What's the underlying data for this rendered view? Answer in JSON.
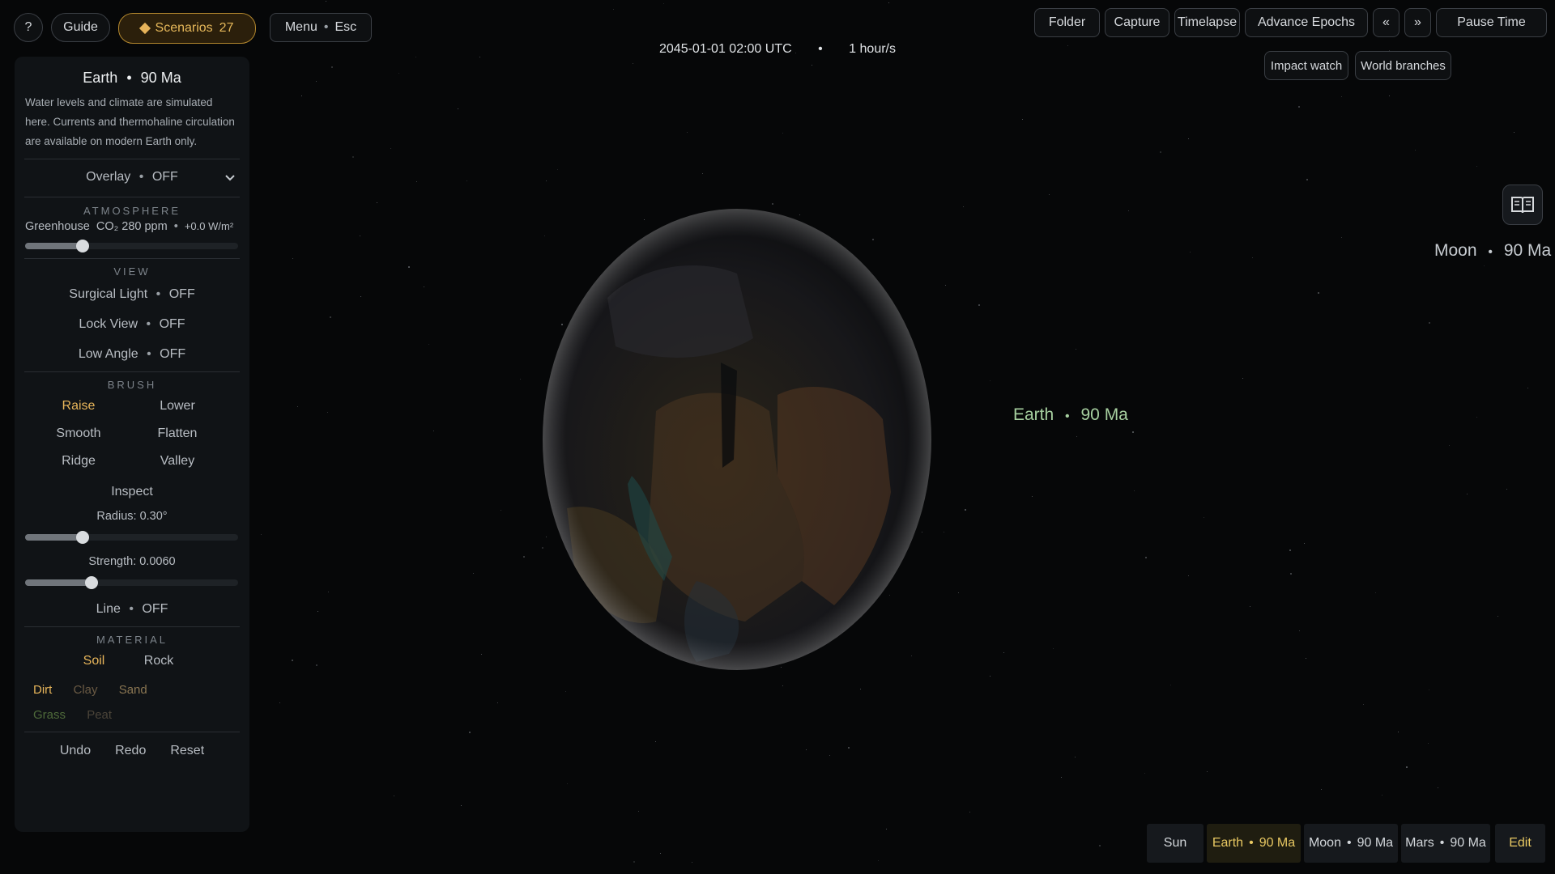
{
  "topleft": {
    "help_label": "?",
    "guide_label": "Guide",
    "scenarios_label": "Scenarios",
    "scenarios_count": "27",
    "menu_label": "Menu",
    "menu_key": "Esc"
  },
  "time": {
    "datetime": "2045-01-01 02:00 UTC",
    "rate": "1 hour/s",
    "sep": "•"
  },
  "topright": {
    "folder": "Folder",
    "capture": "Capture",
    "timelapse": "Timelapse",
    "advance_epochs": "Advance Epochs",
    "prev": "«",
    "next": "»",
    "pause": "Pause Time",
    "impact_watch": "Impact watch",
    "world_branches": "World branches"
  },
  "panel": {
    "title_body": "Earth",
    "title_epoch": "90 Ma",
    "description": "Water levels and climate are simulated here. Currents and thermohaline circulation are available on modern Earth only.",
    "overlay_label": "Overlay",
    "overlay_value": "OFF",
    "atmosphere_header": "ATMOSPHERE",
    "greenhouse_label": "Greenhouse",
    "greenhouse_co2": "CO₂ 280 ppm",
    "greenhouse_forcing": "+0.0 W/m²",
    "greenhouse_level": 0.27,
    "view_header": "VIEW",
    "surgical_label": "Surgical Light",
    "surgical_value": "OFF",
    "lock_label": "Lock View",
    "lock_value": "OFF",
    "low_label": "Low Angle",
    "low_value": "OFF",
    "brush_header": "BRUSH",
    "brush": [
      "Raise",
      "Lower",
      "Smooth",
      "Flatten",
      "Ridge",
      "Valley"
    ],
    "inspect": "Inspect",
    "radius_label": "Radius: 0.30°",
    "radius_level": 0.27,
    "strength_label": "Strength: 0.0060",
    "strength_level": 0.31,
    "line_label": "Line",
    "line_value": "OFF",
    "material_header": "MATERIAL",
    "material_soil": "Soil",
    "material_rock": "Rock",
    "soil_types": [
      "Dirt",
      "Clay",
      "Sand"
    ],
    "soil_types2": [
      "Grass",
      "Peat"
    ],
    "undo": "Undo",
    "redo": "Redo",
    "reset": "Reset",
    "sep": "•"
  },
  "labels": {
    "earth_name": "Earth",
    "earth_epoch": "90 Ma",
    "moon_name": "Moon",
    "moon_epoch": "90 Ma",
    "sep": "•"
  },
  "bottom_tabs": {
    "sun": "Sun",
    "earth_name": "Earth",
    "earth_epoch": "90 Ma",
    "moon_name": "Moon",
    "moon_epoch": "90 Ma",
    "mars_name": "Mars",
    "mars_epoch": "90 Ma",
    "edit": "Edit",
    "sep": "•"
  },
  "colors": {
    "accent": "#e7b55a",
    "earth_label": "#a7d0a0",
    "panel_bg": "#101316",
    "background": "#060708"
  },
  "icons": {
    "book": "book-icon",
    "chevron": "chevron-down-icon",
    "diamond": "diamond-icon"
  }
}
